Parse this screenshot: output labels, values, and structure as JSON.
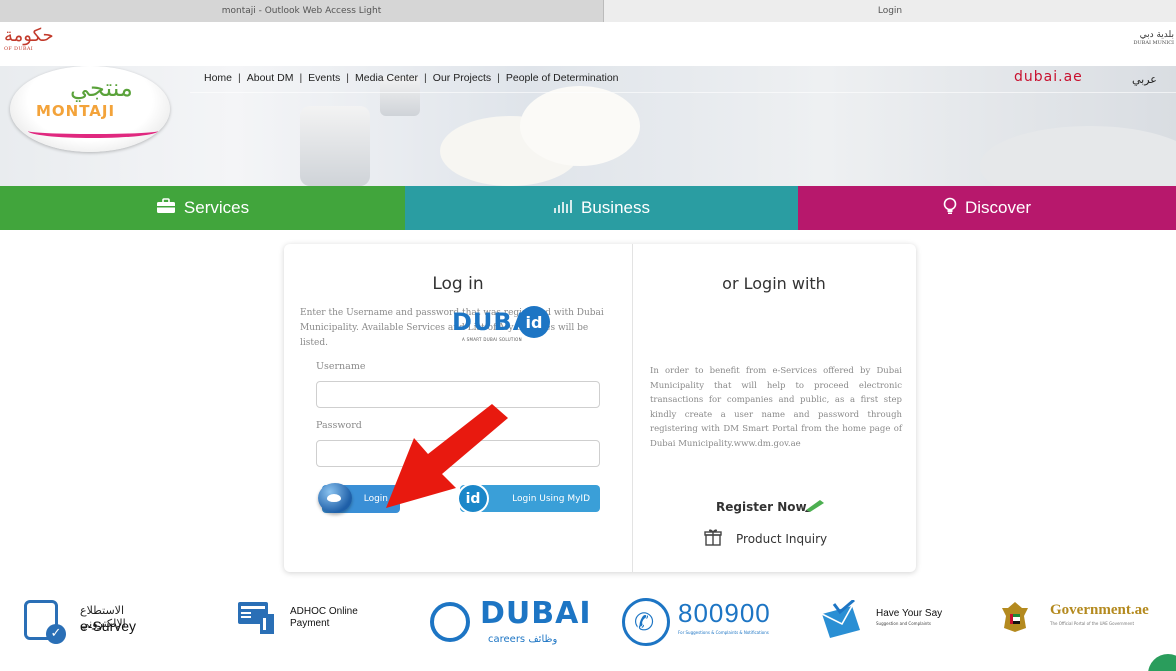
{
  "browser": {
    "tabs": [
      "montaji - Outlook Web Access Light",
      "Login"
    ]
  },
  "gov_header": {
    "left_logo_text": "حكومة",
    "left_logo_sub": "OF DUBAI",
    "right_logo_text": "بلدية دبي",
    "right_logo_sub": "DUBAI MUNICI"
  },
  "logo": {
    "arabic": "منتجي",
    "english": "MONTAJI"
  },
  "nav": {
    "items": [
      "Home",
      "About DM",
      "Events",
      "Media Center",
      "Our Projects",
      "People of Determination"
    ],
    "separator": "|",
    "dubai_ae": "dubai.ae",
    "arabic_link": "عربي"
  },
  "categories": {
    "services": "Services",
    "business": "Business",
    "discover": "Discover"
  },
  "login": {
    "title": "Log in",
    "description": "Enter the Username and password that was registered with Dubai Municipality. Available Services and List of My Services will be listed.",
    "username_label": "Username",
    "username_value": "",
    "password_label": "Password",
    "password_value": "",
    "login_button": "Login",
    "myid_button": "Login Using MyID",
    "myid_badge": "id"
  },
  "alt_login": {
    "title": "or Login with",
    "dubai_id_word": "DUBAI",
    "dubai_id_badge": "id",
    "dubai_id_tag": "A SMART DUBAI SOLUTION",
    "description": "In order to benefit from e-Services offered by Dubai Municipality that will help to proceed electronic transactions for companies and public, as a first step kindly create a user name and password through registering with DM Smart Portal from the home page of Dubai Municipality.www.dm.gov.ae",
    "register_now": "Register Now",
    "product_inquiry": "Product Inquiry"
  },
  "bottom_links": {
    "esurvey_ar": "الاستطلاع الإلكتروني",
    "esurvey_en": "e-Survey",
    "adhoc_line1": "ADHOC Online",
    "adhoc_line2": "Payment",
    "careers_word": "DUBAI",
    "careers_sub": "careers وظائف",
    "phone": "800900",
    "phone_tag": "For Suggestions & Complaints & Notifications",
    "say_title": "Have Your Say",
    "say_sub": "Suggestion and Complaints",
    "gov_title": "Government.ae",
    "gov_sub": "The Official Portal of the UAE Government"
  },
  "colors": {
    "services": "#41a53c",
    "business": "#2a9da2",
    "discover": "#b7186c",
    "brand_blue": "#1d75c4",
    "arrow_red": "#e8190f"
  }
}
